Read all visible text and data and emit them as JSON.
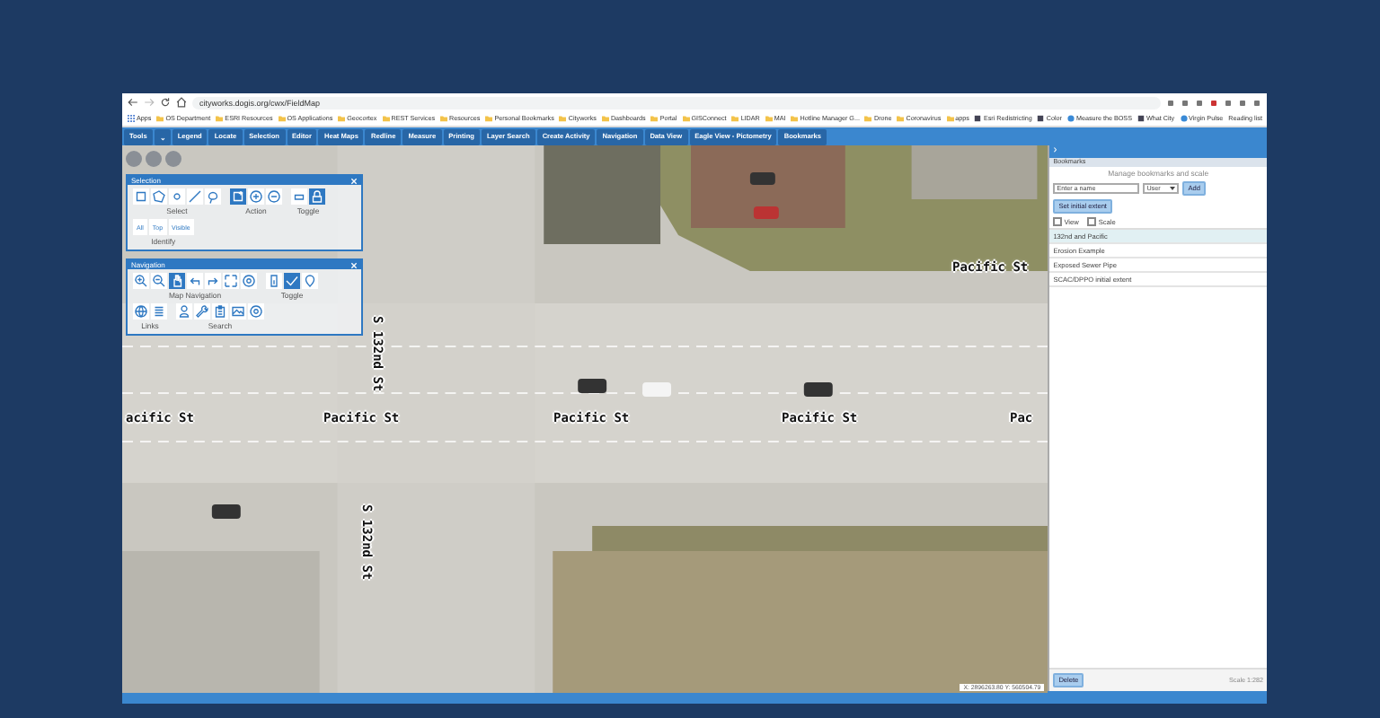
{
  "browser": {
    "url": "cityworks.dogis.org/cwx/FieldMap",
    "bookmarks": [
      {
        "label": "Apps",
        "kind": "apps"
      },
      {
        "label": "OS Department",
        "kind": "folder"
      },
      {
        "label": "ESRI Resources",
        "kind": "folder"
      },
      {
        "label": "OS Applications",
        "kind": "folder"
      },
      {
        "label": "Geocortex",
        "kind": "folder"
      },
      {
        "label": "REST Services",
        "kind": "folder"
      },
      {
        "label": "Resources",
        "kind": "folder"
      },
      {
        "label": "Personal Bookmarks",
        "kind": "folder"
      },
      {
        "label": "Cityworks",
        "kind": "folder"
      },
      {
        "label": "Dashboards",
        "kind": "folder"
      },
      {
        "label": "Portal",
        "kind": "folder"
      },
      {
        "label": "GISConnect",
        "kind": "folder"
      },
      {
        "label": "LIDAR",
        "kind": "folder"
      },
      {
        "label": "MAI",
        "kind": "folder"
      },
      {
        "label": "Hotline Manager G...",
        "kind": "folder"
      },
      {
        "label": "Drone",
        "kind": "folder"
      },
      {
        "label": "Coronavirus",
        "kind": "folder"
      },
      {
        "label": "apps",
        "kind": "folder"
      },
      {
        "label": "Esri Redistricting",
        "kind": "page"
      },
      {
        "label": "Color",
        "kind": "page"
      },
      {
        "label": "Measure the BOSS",
        "kind": "globe"
      },
      {
        "label": "What City",
        "kind": "page"
      },
      {
        "label": "Virgin Pulse",
        "kind": "globe"
      }
    ],
    "reading_list": "Reading list"
  },
  "toolbar": {
    "tabs": [
      "Tools",
      "⌄",
      "Legend",
      "Locate",
      "Selection",
      "Editor",
      "Heat Maps",
      "Redline",
      "Measure",
      "Printing",
      "Layer Search",
      "Create Activity",
      "Navigation",
      "Data View",
      "Eagle View - Pictometry",
      "Bookmarks"
    ]
  },
  "map": {
    "street_labels": [
      {
        "text": "Pacific St",
        "kind": "horizontal"
      },
      {
        "text": "S 132nd St",
        "kind": "vertical"
      },
      {
        "text": "acific St",
        "kind": "horizontal"
      },
      {
        "text": "Pacific St",
        "kind": "horizontal"
      },
      {
        "text": "Pacific St",
        "kind": "horizontal"
      },
      {
        "text": "Pacific St",
        "kind": "horizontal"
      },
      {
        "text": "Pac",
        "kind": "horizontal"
      },
      {
        "text": "S 132nd St",
        "kind": "vertical"
      }
    ],
    "coordinates": "X: 2896263.80 Y: 560504.79"
  },
  "panels": [
    {
      "title": "Selection",
      "groups": [
        {
          "label": "Select",
          "tools": [
            {
              "kind": "rectangle",
              "selected": false
            },
            {
              "kind": "polygon",
              "selected": false
            },
            {
              "kind": "point",
              "selected": false
            },
            {
              "kind": "line",
              "selected": false
            },
            {
              "kind": "lasso",
              "selected": false
            }
          ]
        },
        {
          "label": "Action",
          "tools": [
            {
              "kind": "new",
              "selected": true
            },
            {
              "kind": "add",
              "selected": false
            },
            {
              "kind": "remove",
              "selected": false
            }
          ]
        },
        {
          "label": "Toggle",
          "tools": [
            {
              "kind": "clear",
              "selected": false
            },
            {
              "kind": "lock",
              "selected": true
            }
          ]
        },
        {
          "label": "Identify",
          "tools": [
            {
              "kind": "text",
              "text": "All",
              "selected": false
            },
            {
              "kind": "text",
              "text": "Top",
              "selected": false
            },
            {
              "kind": "text",
              "text": "Visible",
              "selected": false
            }
          ]
        }
      ]
    },
    {
      "title": "Navigation",
      "groups": [
        {
          "label": "Map Navigation",
          "tools": [
            {
              "kind": "zoom-in",
              "selected": false
            },
            {
              "kind": "zoom-out",
              "selected": false
            },
            {
              "kind": "pan",
              "selected": true
            },
            {
              "kind": "back",
              "selected": false
            },
            {
              "kind": "forward",
              "selected": false
            },
            {
              "kind": "extent",
              "selected": false
            },
            {
              "kind": "target",
              "selected": false
            }
          ]
        },
        {
          "label": "Toggle",
          "tools": [
            {
              "kind": "info",
              "selected": false
            },
            {
              "kind": "check",
              "selected": true
            },
            {
              "kind": "pin",
              "selected": false
            }
          ]
        },
        {
          "label": "Links",
          "tools": [
            {
              "kind": "globe",
              "selected": false
            },
            {
              "kind": "list",
              "selected": false
            }
          ]
        },
        {
          "label": "Search",
          "tools": [
            {
              "kind": "person",
              "selected": false
            },
            {
              "kind": "wrench",
              "selected": false
            },
            {
              "kind": "clipboard",
              "selected": false
            },
            {
              "kind": "image",
              "selected": false
            },
            {
              "kind": "target",
              "selected": false
            }
          ]
        }
      ]
    }
  ],
  "bookmarks_panel": {
    "collapse": "›",
    "title": "Bookmarks",
    "subtitle": "Manage bookmarks and scale",
    "name_placeholder": "Enter a name",
    "type_value": "User",
    "add": "Add",
    "set_initial": "Set initial extent",
    "options": [
      {
        "label": "View",
        "selected": false
      },
      {
        "label": "Scale",
        "selected": false
      }
    ],
    "items": [
      {
        "label": "132nd and Pacific",
        "selected": true
      },
      {
        "label": "Erosion Example",
        "selected": false
      },
      {
        "label": "Exposed Sewer Pipe",
        "selected": false
      },
      {
        "label": "SCAC/DPPO initial extent",
        "selected": false
      }
    ],
    "delete": "Delete",
    "scale": "Scale 1:282"
  }
}
